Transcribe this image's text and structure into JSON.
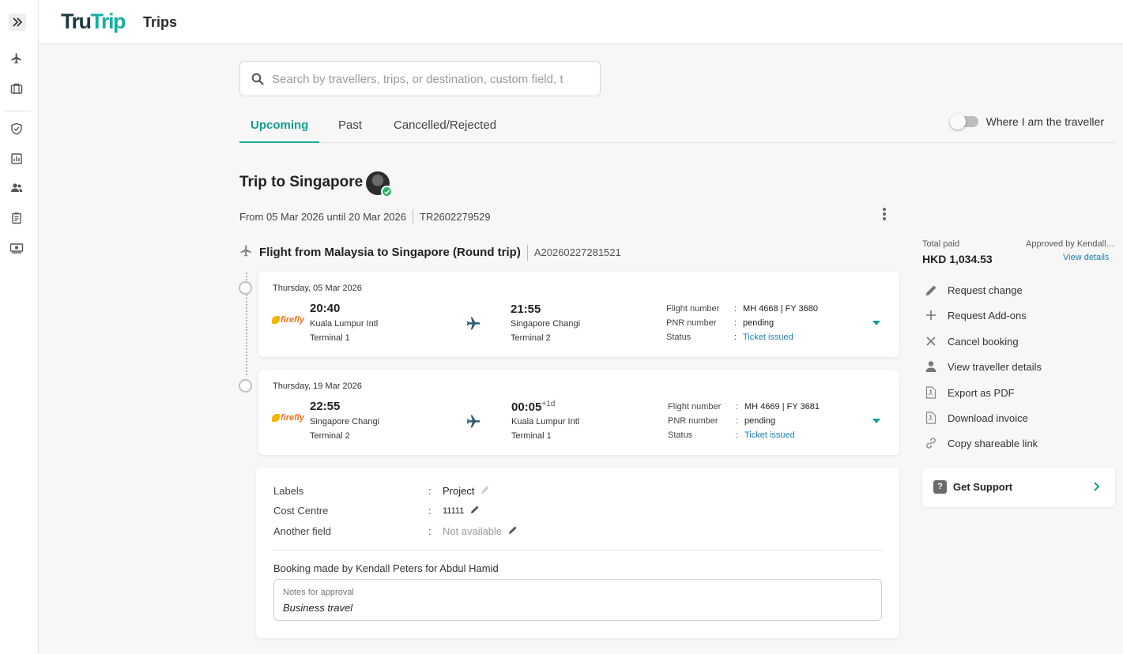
{
  "app": {
    "logo_part1": "Tru",
    "logo_part2": "Trip",
    "page_title": "Trips"
  },
  "colors": {
    "brand": "#15b0a2",
    "brand_dark": "#1d3b42",
    "link": "#1a7fb5",
    "success": "#2fb36b"
  },
  "sidebar": {
    "icons": [
      "expand-icon",
      "flight-icon",
      "briefcase-icon",
      "shield-check-icon",
      "report-icon",
      "users-icon",
      "clipboard-icon",
      "money-icon"
    ]
  },
  "search": {
    "placeholder": "Search by travellers, trips, or destination, custom field, t",
    "value": ""
  },
  "tabs": [
    {
      "label": "Upcoming",
      "active": true
    },
    {
      "label": "Past",
      "active": false
    },
    {
      "label": "Cancelled/Rejected",
      "active": false
    }
  ],
  "toggle": {
    "label": "Where I am the traveller",
    "on": false
  },
  "trip": {
    "title": "Trip to Singapore",
    "dates": "From 05 Mar 2026 until 20 Mar 2026",
    "ref": "TR2602279529"
  },
  "flight": {
    "title": "Flight from Malaysia to Singapore (Round trip)",
    "ref": "A20260227281521"
  },
  "segments": [
    {
      "date": "Thursday, 05 Mar 2026",
      "airline": "firefly",
      "dep_time": "20:40",
      "dep_place": "Kuala Lumpur Intl",
      "dep_terminal": "Terminal 1",
      "arr_time": "21:55",
      "arr_offset": "",
      "arr_place": "Singapore Changi",
      "arr_terminal": "Terminal 2",
      "labels": {
        "flight": "Flight number",
        "pnr": "PNR number",
        "status": "Status"
      },
      "flight_number": "MH 4668 | FY 3680",
      "pnr": "pending",
      "status": "Ticket issued"
    },
    {
      "date": "Thursday, 19 Mar 2026",
      "airline": "firefly",
      "dep_time": "22:55",
      "dep_place": "Singapore Changi",
      "dep_terminal": "Terminal 2",
      "arr_time": "00:05",
      "arr_offset": "+1d",
      "arr_place": "Kuala Lumpur Intl",
      "arr_terminal": "Terminal 1",
      "labels": {
        "flight": "Flight number",
        "pnr": "PNR number",
        "status": "Status"
      },
      "flight_number": "MH 4669 | FY 3681",
      "pnr": "pending",
      "status": "Ticket issued"
    }
  ],
  "details": {
    "fields": [
      {
        "label": "Labels",
        "value": "Project"
      },
      {
        "label": "Cost Centre",
        "value": "11111"
      },
      {
        "label": "Another field",
        "value": "Not available"
      }
    ],
    "colon": ":",
    "byline": "Booking made by Kendall Peters for Abdul Hamid",
    "notes_label": "Notes for approval",
    "notes_value": "Business travel"
  },
  "payment": {
    "total_label": "Total paid",
    "total_value": "HKD 1,034.53",
    "approved_by": "Approved by Kendall Peters",
    "view_details": "View details"
  },
  "actions": [
    {
      "label": "Request change",
      "icon": "pencil-icon"
    },
    {
      "label": "Request Add-ons",
      "icon": "plus-icon"
    },
    {
      "label": "Cancel booking",
      "icon": "close-icon"
    },
    {
      "label": "View traveller details",
      "icon": "person-icon"
    },
    {
      "label": "Export as PDF",
      "icon": "pdf-icon"
    },
    {
      "label": "Download invoice",
      "icon": "invoice-icon"
    },
    {
      "label": "Copy shareable link",
      "icon": "link-icon"
    }
  ],
  "support": {
    "label": "Get Support",
    "icon_glyph": "?"
  }
}
